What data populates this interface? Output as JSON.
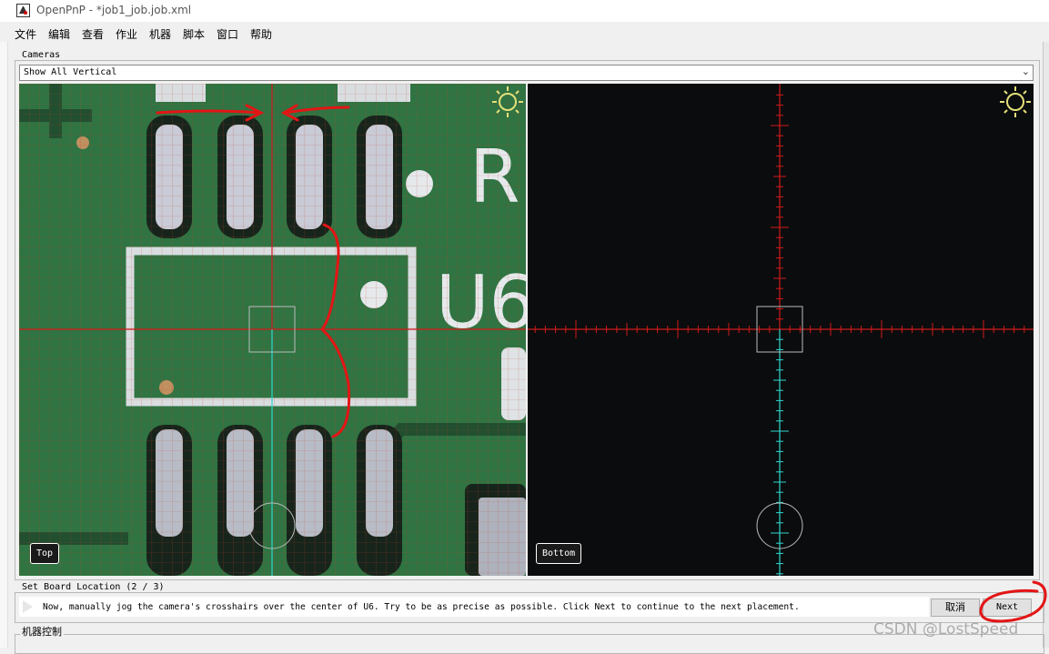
{
  "window": {
    "title": "OpenPnP - *job1_job.job.xml"
  },
  "menu": {
    "items": [
      "文件",
      "编辑",
      "查看",
      "作业",
      "机器",
      "脚本",
      "窗口",
      "帮助"
    ]
  },
  "cameras_panel": {
    "title": "Cameras",
    "view_mode": "Show All Vertical",
    "top_camera": {
      "label": "Top",
      "pcb_silkscreen": "RU6"
    },
    "bottom_camera": {
      "label": "Bottom"
    }
  },
  "wizard": {
    "title": "Set Board Location (2 / 3)",
    "instruction": "Now, manually jog the camera's crosshairs over the center of U6. Try to be as precise as possible. Click Next to continue to the next placement.",
    "cancel_label": "取消",
    "next_label": "Next"
  },
  "machine_controls": {
    "title": "机器控制"
  },
  "watermark": "CSDN @LostSpeed",
  "colors": {
    "pcb_green": "#2f7442",
    "crosshair_red": "#d01a1a",
    "crosshair_cyan": "#2fd6d0",
    "annotation_red": "#e31515",
    "camera_bg_dark": "#0b0c0d"
  }
}
